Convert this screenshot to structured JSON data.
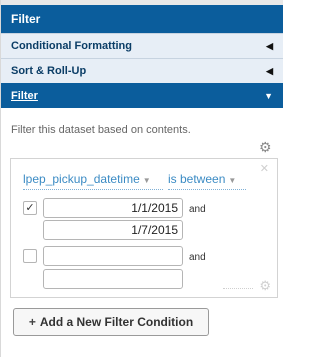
{
  "panel": {
    "title": "Filter"
  },
  "sections": [
    {
      "label": "Conditional Formatting",
      "state": "collapsed"
    },
    {
      "label": "Sort & Roll-Up",
      "state": "collapsed"
    },
    {
      "label": "Filter",
      "state": "expanded"
    }
  ],
  "filter": {
    "description": "Filter this dataset based on contents.",
    "condition": {
      "field": "lpep_pickup_datetime",
      "operator": "is between",
      "rows": [
        {
          "checked": true,
          "value1": "1/1/2015",
          "joiner": "and",
          "value2": "1/7/2015"
        },
        {
          "checked": false,
          "value1": "",
          "joiner": "and",
          "value2": ""
        }
      ]
    },
    "add_button_label": "Add a New Filter Condition"
  },
  "colors": {
    "accent": "#0b5d9c",
    "section_bg": "#e7eef6",
    "link": "#3b8bc4"
  },
  "icons": {
    "collapsed_arrow": "triangle-left-icon",
    "expanded_arrow": "triangle-down-icon",
    "gear": "gear-icon",
    "close": "close-icon",
    "check": "check-icon",
    "plus": "plus-icon"
  }
}
